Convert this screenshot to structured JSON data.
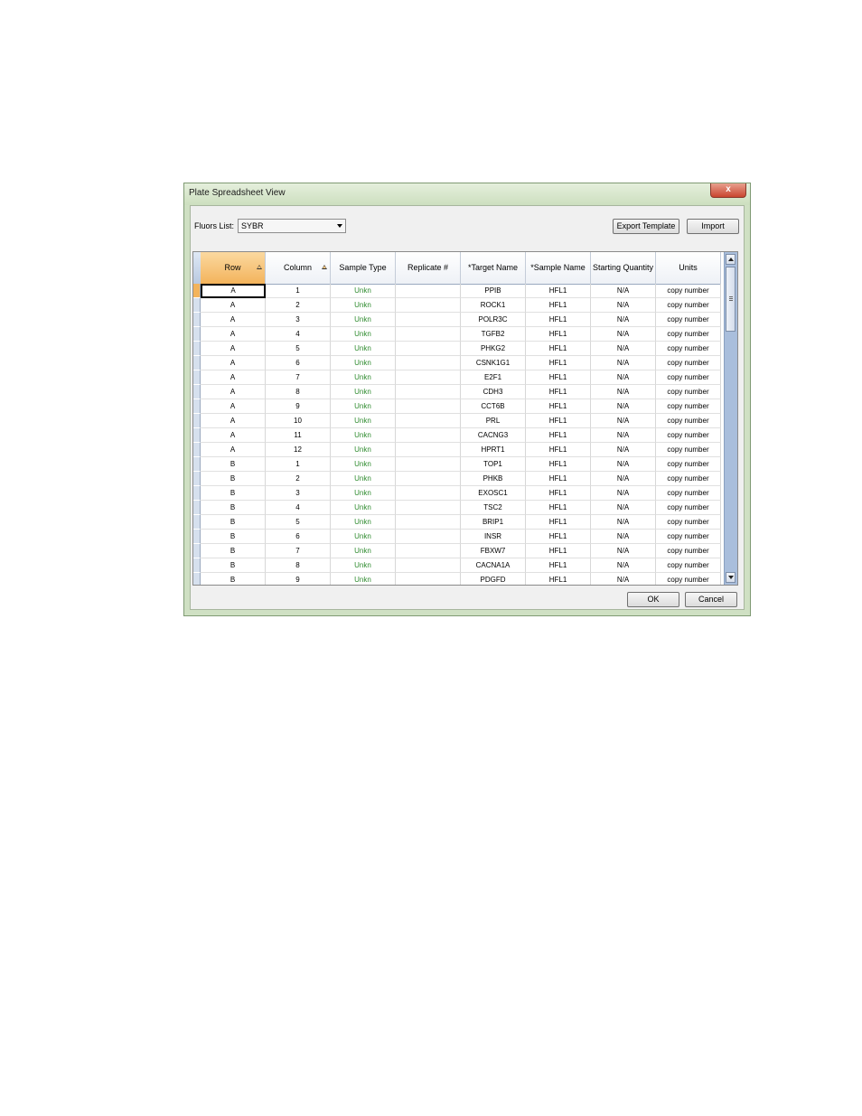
{
  "window": {
    "title": "Plate Spreadsheet View",
    "close_label": "x"
  },
  "toolbar": {
    "fluors_label": "Fluors List:",
    "fluors_value": "SYBR",
    "export_label": "Export Template",
    "import_label": "Import"
  },
  "table": {
    "columns": [
      {
        "label": "Row",
        "sorted": true
      },
      {
        "label": "Column",
        "sorted": true
      },
      {
        "label": "Sample Type",
        "sorted": false
      },
      {
        "label": "Replicate #",
        "sorted": false
      },
      {
        "label": "*Target Name",
        "sorted": false
      },
      {
        "label": "*Sample Name",
        "sorted": false
      },
      {
        "label": "Starting Quantity",
        "sorted": false
      },
      {
        "label": "Units",
        "sorted": false
      }
    ],
    "rows": [
      [
        "A",
        "1",
        "Unkn",
        "",
        "PPIB",
        "HFL1",
        "N/A",
        "copy number"
      ],
      [
        "A",
        "2",
        "Unkn",
        "",
        "ROCK1",
        "HFL1",
        "N/A",
        "copy number"
      ],
      [
        "A",
        "3",
        "Unkn",
        "",
        "POLR3C",
        "HFL1",
        "N/A",
        "copy number"
      ],
      [
        "A",
        "4",
        "Unkn",
        "",
        "TGFB2",
        "HFL1",
        "N/A",
        "copy number"
      ],
      [
        "A",
        "5",
        "Unkn",
        "",
        "PHKG2",
        "HFL1",
        "N/A",
        "copy number"
      ],
      [
        "A",
        "6",
        "Unkn",
        "",
        "CSNK1G1",
        "HFL1",
        "N/A",
        "copy number"
      ],
      [
        "A",
        "7",
        "Unkn",
        "",
        "E2F1",
        "HFL1",
        "N/A",
        "copy number"
      ],
      [
        "A",
        "8",
        "Unkn",
        "",
        "CDH3",
        "HFL1",
        "N/A",
        "copy number"
      ],
      [
        "A",
        "9",
        "Unkn",
        "",
        "CCT6B",
        "HFL1",
        "N/A",
        "copy number"
      ],
      [
        "A",
        "10",
        "Unkn",
        "",
        "PRL",
        "HFL1",
        "N/A",
        "copy number"
      ],
      [
        "A",
        "11",
        "Unkn",
        "",
        "CACNG3",
        "HFL1",
        "N/A",
        "copy number"
      ],
      [
        "A",
        "12",
        "Unkn",
        "",
        "HPRT1",
        "HFL1",
        "N/A",
        "copy number"
      ],
      [
        "B",
        "1",
        "Unkn",
        "",
        "TOP1",
        "HFL1",
        "N/A",
        "copy number"
      ],
      [
        "B",
        "2",
        "Unkn",
        "",
        "PHKB",
        "HFL1",
        "N/A",
        "copy number"
      ],
      [
        "B",
        "3",
        "Unkn",
        "",
        "EXOSC1",
        "HFL1",
        "N/A",
        "copy number"
      ],
      [
        "B",
        "4",
        "Unkn",
        "",
        "TSC2",
        "HFL1",
        "N/A",
        "copy number"
      ],
      [
        "B",
        "5",
        "Unkn",
        "",
        "BRIP1",
        "HFL1",
        "N/A",
        "copy number"
      ],
      [
        "B",
        "6",
        "Unkn",
        "",
        "INSR",
        "HFL1",
        "N/A",
        "copy number"
      ],
      [
        "B",
        "7",
        "Unkn",
        "",
        "FBXW7",
        "HFL1",
        "N/A",
        "copy number"
      ],
      [
        "B",
        "8",
        "Unkn",
        "",
        "CACNA1A",
        "HFL1",
        "N/A",
        "copy number"
      ],
      [
        "B",
        "9",
        "Unkn",
        "",
        "PDGFD",
        "HFL1",
        "N/A",
        "copy number"
      ]
    ]
  },
  "footer": {
    "ok_label": "OK",
    "cancel_label": "Cancel"
  },
  "colors": {
    "sorted_header": "#f3b35b",
    "sample_type_text": "#2e8b2e",
    "window_frame": "#cfe0c3"
  },
  "icons": {
    "close": "close-icon",
    "dropdown": "chevron-down-icon",
    "sort": "sort-ascending-icon",
    "scroll_up": "arrow-up-icon",
    "scroll_down": "arrow-down-icon"
  }
}
